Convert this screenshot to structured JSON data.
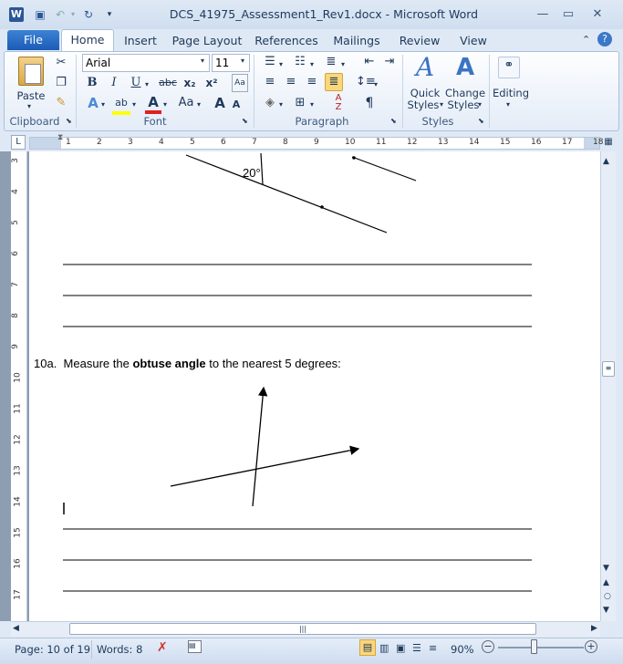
{
  "window": {
    "title": "DCS_41975_Assessment1_Rev1.docx - Microsoft Word"
  },
  "tabs": {
    "file": "File",
    "home": "Home",
    "insert": "Insert",
    "page_layout": "Page Layout",
    "references": "References",
    "mailings": "Mailings",
    "review": "Review",
    "view": "View"
  },
  "clipboard": {
    "paste": "Paste",
    "label": "Clipboard"
  },
  "font": {
    "name": "Arial",
    "size": "11",
    "label": "Font",
    "bold": "B",
    "italic": "I",
    "underline": "U",
    "strike": "abc",
    "sub": "x₂",
    "sup": "x²",
    "grow": "A",
    "case": "Aa"
  },
  "paragraph": {
    "label": "Paragraph",
    "pilcrow": "¶"
  },
  "styles": {
    "quick": "Quick\nStyles",
    "quick1": "Quick",
    "quick2": "Styles",
    "change1": "Change",
    "change2": "Styles",
    "label": "Styles"
  },
  "editing": {
    "label": "Editing"
  },
  "ruler": {
    "ticks": [
      "1",
      "2",
      "3",
      "4",
      "5",
      "6",
      "7",
      "8",
      "9",
      "10",
      "11",
      "12",
      "13",
      "14",
      "15",
      "16",
      "17",
      "18"
    ],
    "vticks": [
      "3",
      "4",
      "5",
      "6",
      "7",
      "8",
      "9",
      "10",
      "11",
      "12",
      "13",
      "14",
      "15",
      "16",
      "17"
    ]
  },
  "document": {
    "angle_label": "20°",
    "question_number": "10a.",
    "question_pre": "Measure the",
    "question_bold": "obtuse angle",
    "question_post": "to the nearest 5 degrees:"
  },
  "status": {
    "page": "Page: 10 of 19",
    "words": "Words: 8",
    "zoom": "90%"
  }
}
